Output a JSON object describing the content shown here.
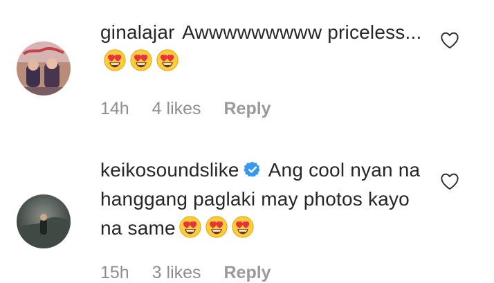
{
  "comments": [
    {
      "username": "ginalajar",
      "text": "Awwwwwwwww priceless...",
      "emoji": "heart-eyes-emoji",
      "emoji_count": 3,
      "verified": false,
      "time": "14h",
      "likes": "4 likes",
      "reply": "Reply"
    },
    {
      "username": "keikosoundslike",
      "text": "Ang cool nyan na hanggang paglaki may photos kayo na same",
      "emoji": "heart-eyes-emoji",
      "emoji_count": 3,
      "verified": true,
      "time": "15h",
      "likes": "3 likes",
      "reply": "Reply"
    }
  ],
  "colors": {
    "text": "#262626",
    "meta": "#8e8e8e",
    "verified": "#3897f0",
    "emoji_face": "#ffcc3e",
    "emoji_heart": "#e8323c"
  }
}
